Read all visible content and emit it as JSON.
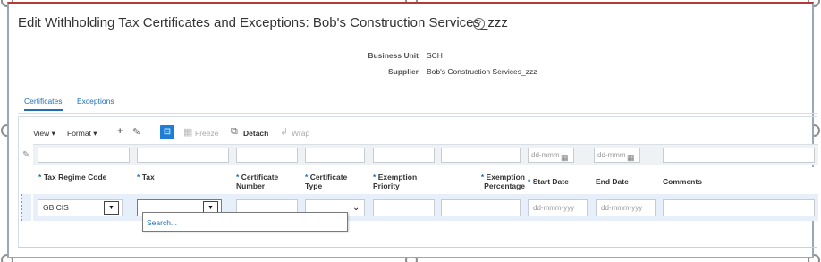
{
  "page": {
    "title": "Edit Withholding Tax Certificates and Exceptions: Bob's Construction Services_zzz",
    "help_icon": "?"
  },
  "info": {
    "business_unit_label": "Business Unit",
    "business_unit_value": "SCH",
    "supplier_label": "Supplier",
    "supplier_value": "Bob's Construction Services_zzz"
  },
  "tabs": [
    {
      "label": "Certificates",
      "active": true
    },
    {
      "label": "Exceptions",
      "active": false
    }
  ],
  "toolbar": {
    "view_label": "View",
    "format_label": "Format",
    "freeze_label": "Freeze",
    "detach_label": "Detach",
    "wrap_label": "Wrap"
  },
  "filter": {
    "start_date_placeholder": "dd-mmm",
    "end_date_placeholder": "dd-mmm"
  },
  "columns": [
    {
      "label": "Tax Regime Code",
      "required": true
    },
    {
      "label": "Tax",
      "required": true
    },
    {
      "label": "Certificate Number",
      "required": true
    },
    {
      "label": "Certificate Type",
      "required": true
    },
    {
      "label": "Exemption Priority",
      "required": true
    },
    {
      "label": "Exemption Percentage",
      "required": true
    },
    {
      "label": "Start Date",
      "required": true
    },
    {
      "label": "End Date",
      "required": false
    },
    {
      "label": "Comments",
      "required": false
    }
  ],
  "row": {
    "tax_regime_code": "GB CIS",
    "tax": "",
    "start_date_placeholder": "dd-mmm-yyy",
    "end_date_placeholder": "dd-mmm-yyy"
  },
  "dropdown": {
    "search_label": "Search..."
  },
  "colors": {
    "accent": "#1f6fb5",
    "row_selected": "#e7f0fa",
    "frame_top": "#b33a3a"
  }
}
